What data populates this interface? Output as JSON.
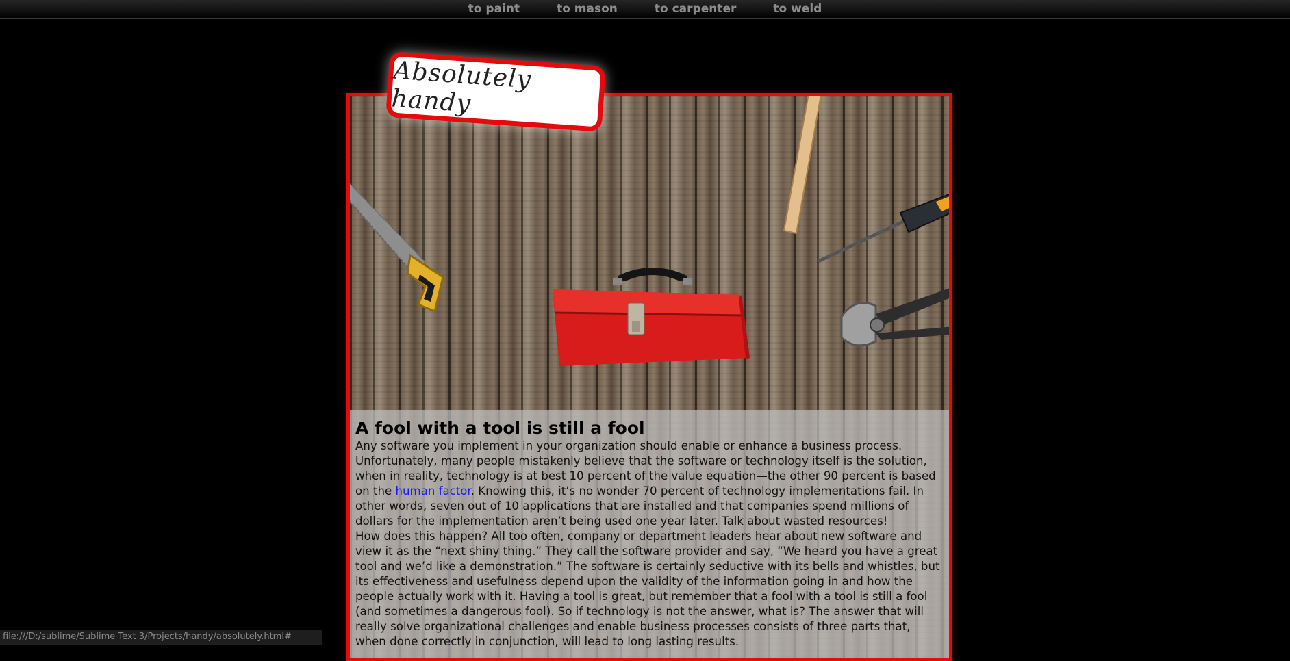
{
  "nav": {
    "items": [
      {
        "label": "to paint"
      },
      {
        "label": "to mason"
      },
      {
        "label": "to carpenter"
      },
      {
        "label": "to weld"
      }
    ]
  },
  "logo": {
    "text": "Absolutely handy"
  },
  "tools": {
    "icons": [
      "hammer-icon",
      "saw-icon",
      "toolbox-icon",
      "screwdriver-icon",
      "pliers-icon"
    ]
  },
  "article": {
    "title": "A fool with a tool is still a fool",
    "p1_before_link": "Any software you implement in your organization should enable or enhance a business process. Unfortunately, many people mistakenly believe that the software or technology itself is the solution, when in reality, technology is at best 10 percent of the value equation—the other 90 percent is based on the ",
    "link_text": "human factor",
    "p1_after_link": ". Knowing this, it’s no wonder 70 percent of technology implementations fail. In other words, seven out of 10 applications that are installed and that companies spend millions of dollars for the implementation aren’t being used one year later. Talk about wasted resources!",
    "p2": "How does this happen? All too often, company or department leaders hear about new software and view it as the “next shiny thing.” They call the software provider and say, “We heard you have a great tool and we’d like a demonstration.” The software is certainly seductive with its bells and whistles, but its effectiveness and usefulness depend upon the validity of the information going in and how the people actually work with it. Having a tool is great, but remember that a fool with a tool is still a fool (and sometimes a dangerous fool). So if technology is not the answer, what is? The answer that will really solve organizational challenges and enable business processes consists of three parts that, when done correctly in conjunction, will lead to long lasting results."
  },
  "status": {
    "url": "file:///D:/sublime/Sublime Text 3/Projects/handy/absolutely.html#"
  },
  "colors": {
    "accent": "#e30b0b",
    "link": "#1a1aff",
    "nav_text": "#8c8c8c"
  }
}
